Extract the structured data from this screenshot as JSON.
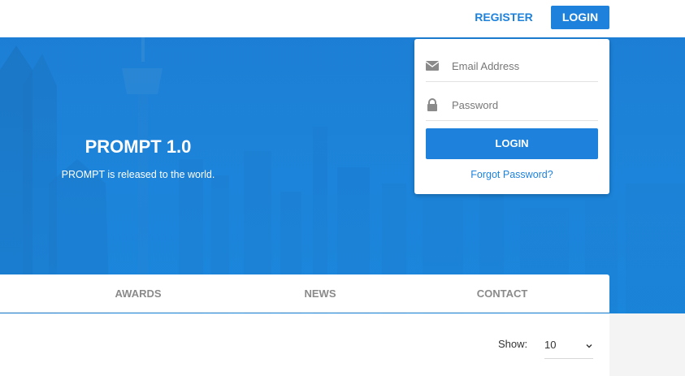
{
  "colors": {
    "accent": "#1e82dc",
    "hero_bg": "#1b84da"
  },
  "nav": {
    "register_label": "REGISTER",
    "login_label": "LOGIN"
  },
  "hero": {
    "title": "PROMPT 1.0",
    "subtitle": "PROMPT is released to the world."
  },
  "login_card": {
    "email_placeholder": "Email Address",
    "password_placeholder": "Password",
    "login_label": "LOGIN",
    "forgot_label": "Forgot Password?",
    "email_icon": "envelope-icon",
    "password_icon": "lock-icon"
  },
  "tabs": [
    {
      "label": "AWARDS"
    },
    {
      "label": "NEWS"
    },
    {
      "label": "CONTACT"
    }
  ],
  "content": {
    "show_label": "Show:",
    "show_value": "10",
    "show_icon": "chevron-down-icon"
  }
}
